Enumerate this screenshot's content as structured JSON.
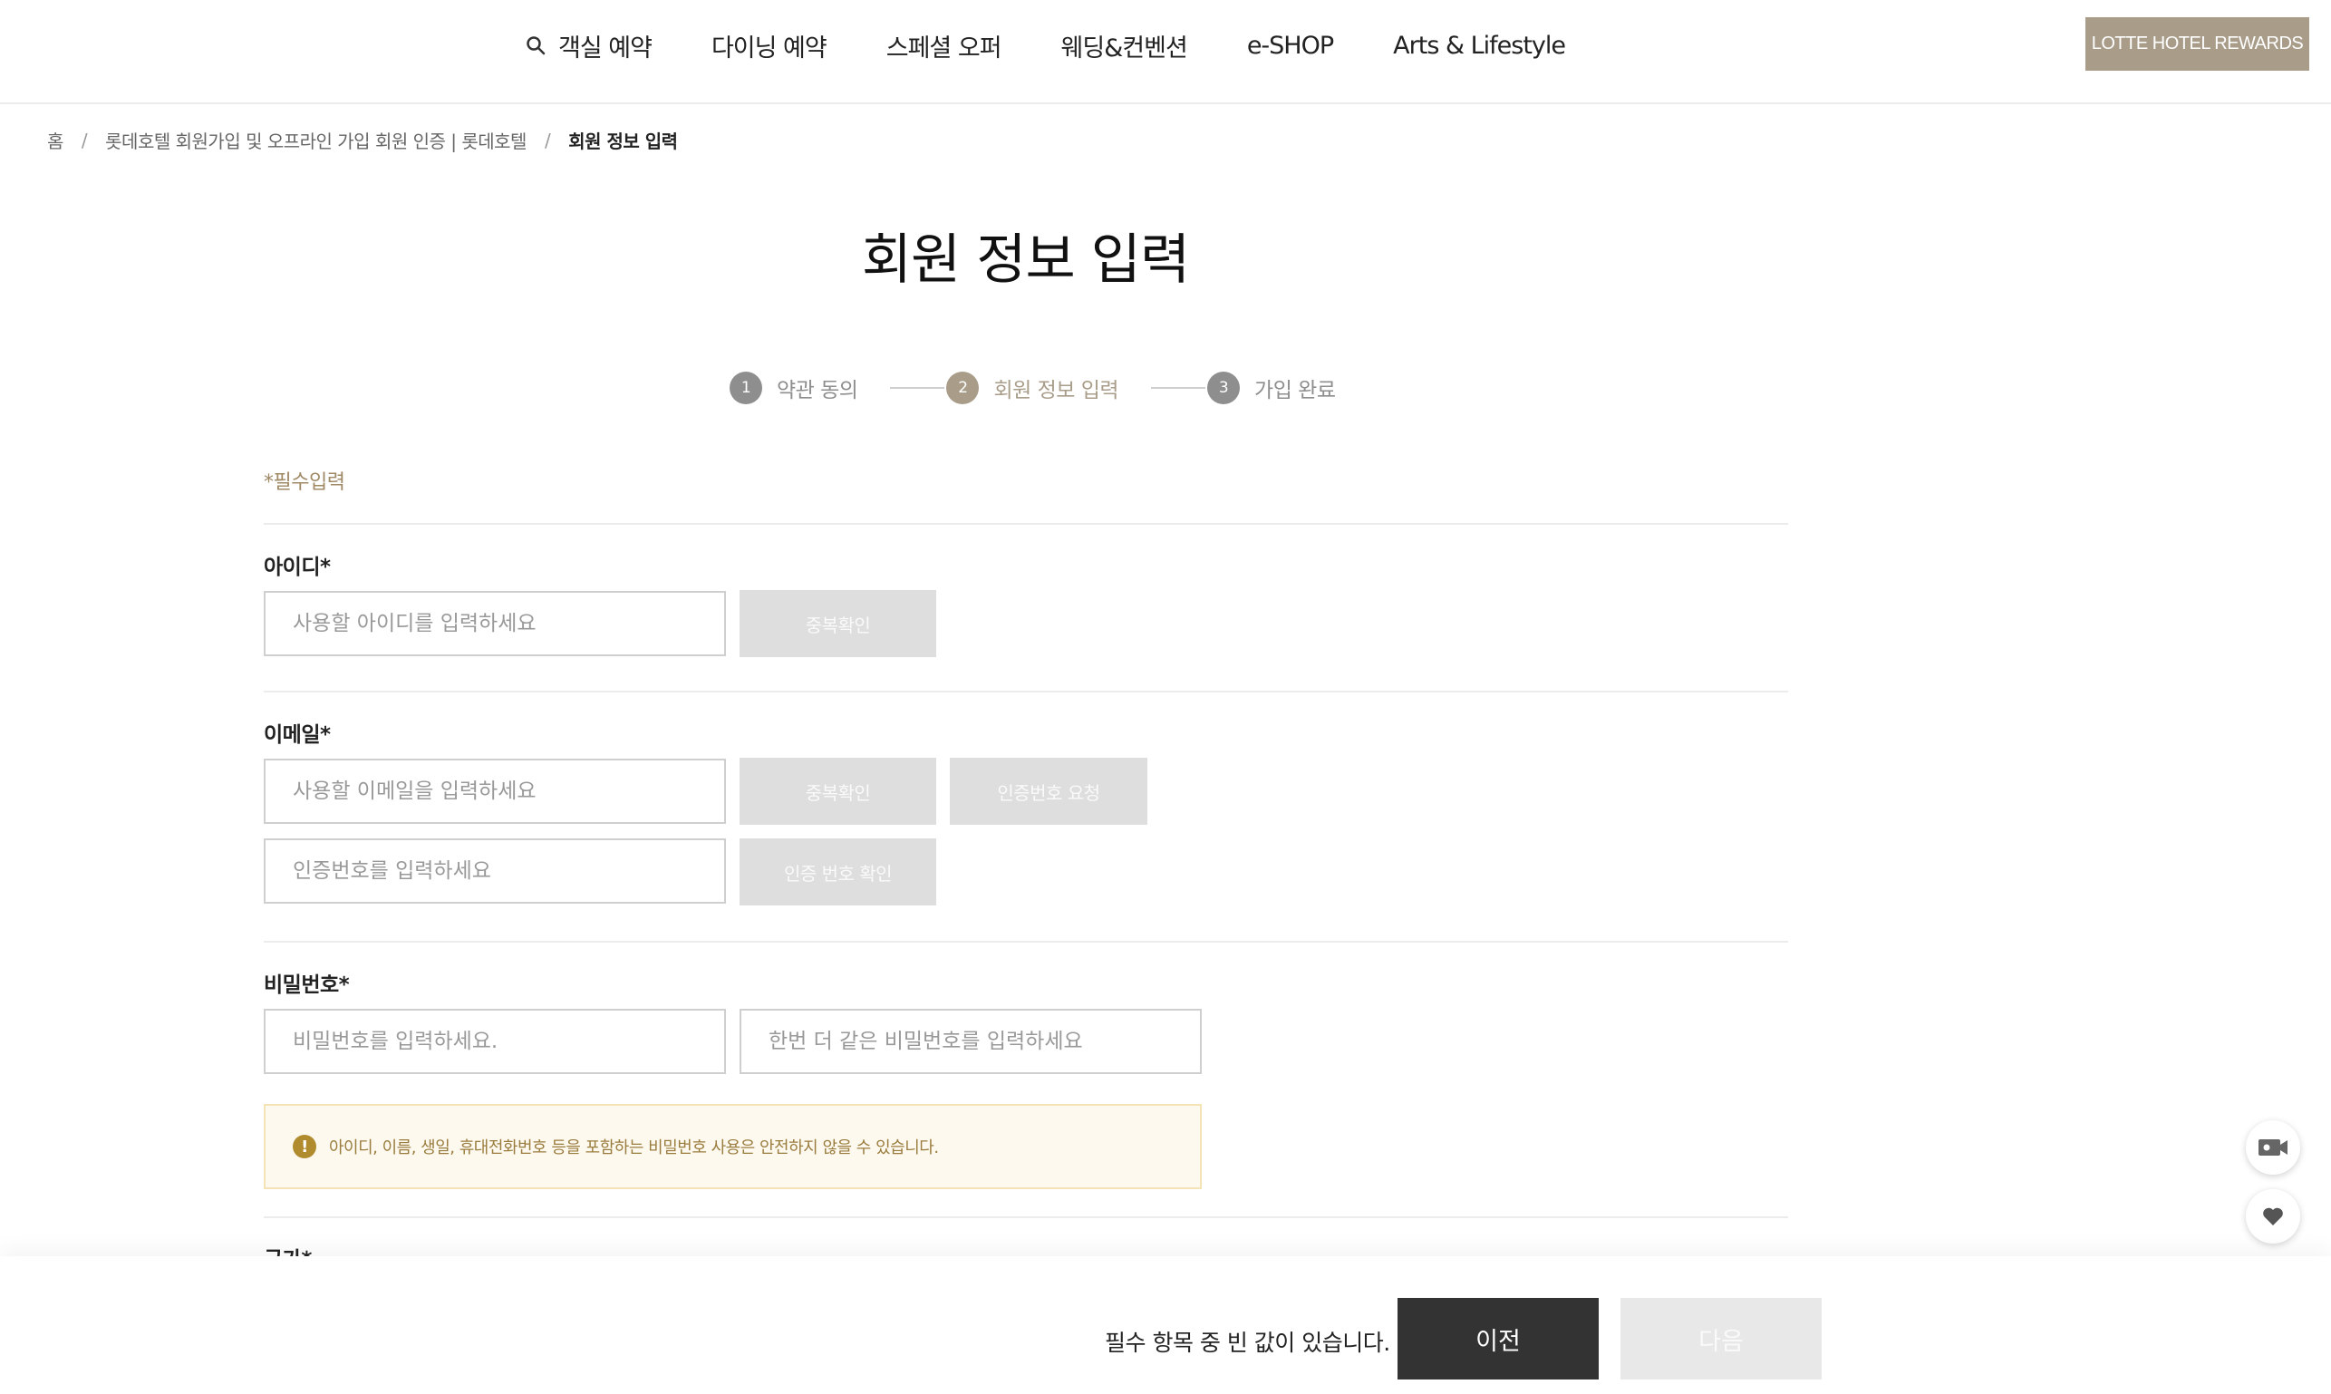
{
  "nav": {
    "items": [
      {
        "label": "객실 예약"
      },
      {
        "label": "다이닝 예약"
      },
      {
        "label": "스페셜 오퍼"
      },
      {
        "label": "웨딩&컨벤션"
      },
      {
        "label": "e-SHOP"
      },
      {
        "label": "Arts & Lifestyle"
      }
    ],
    "rewards_label": "LOTTE HOTEL REWARDS"
  },
  "breadcrumb": {
    "home": "홈",
    "parent": "롯데호텔 회원가입 및 오프라인 가입 회원 인증 | 롯데호텔",
    "current": "회원 정보 입력",
    "separator": "/"
  },
  "page_title": "회원 정보 입력",
  "steps": [
    {
      "num": "1",
      "label": "약관 동의"
    },
    {
      "num": "2",
      "label": "회원 정보 입력"
    },
    {
      "num": "3",
      "label": "가입 완료"
    }
  ],
  "form": {
    "required_note": "*필수입력",
    "id": {
      "label": "아이디*",
      "placeholder": "사용할 아이디를 입력하세요",
      "check_button": "중복확인"
    },
    "email": {
      "label": "이메일*",
      "placeholder": "사용할 이메일을 입력하세요",
      "check_button": "중복확인",
      "request_button": "인증번호 요청",
      "code_placeholder": "인증번호를 입력하세요",
      "code_button": "인증 번호 확인"
    },
    "password": {
      "label": "비밀번호*",
      "placeholder": "비밀번호를 입력하세요.",
      "confirm_placeholder": "한번 더 같은 비밀번호를 입력하세요",
      "warning_icon": "!",
      "warning": "아이디, 이름, 생일, 휴대전화번호 등을 포함하는 비밀번호 사용은 안전하지 않을 수 있습니다."
    },
    "country_label": "국가*"
  },
  "bottom": {
    "message": "필수 항목 중 빈 값이 있습니다.",
    "prev_label": "이전",
    "next_label": "다음"
  }
}
